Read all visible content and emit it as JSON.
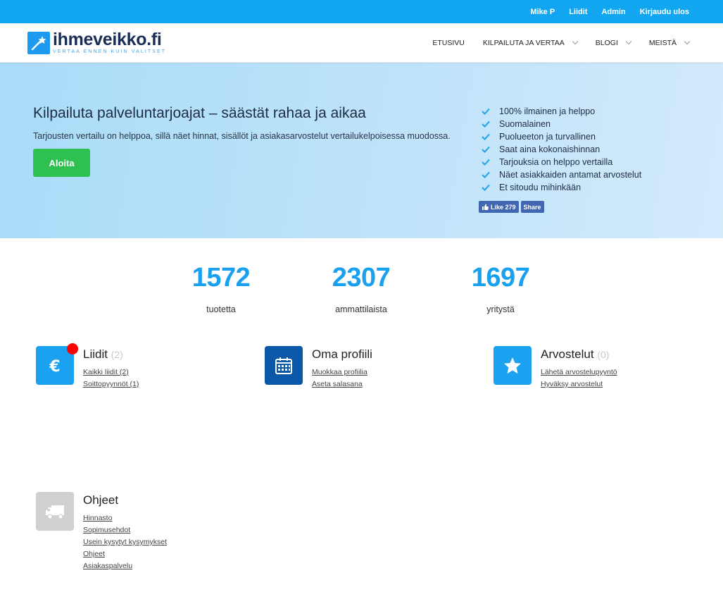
{
  "topbar": {
    "user": "Mike P",
    "leads": "Liidit",
    "admin": "Admin",
    "logout": "Kirjaudu ulos"
  },
  "header": {
    "logo_name": "ihmeveikko.fi",
    "logo_tagline": "VERTAA ENNEN KUIN VALITSET",
    "nav": [
      {
        "label": "ETUSIVU"
      },
      {
        "label": "KILPAILUTA JA VERTAA"
      },
      {
        "label": "BLOGI"
      },
      {
        "label": "MEISTÄ"
      }
    ]
  },
  "hero": {
    "title": "Kilpailuta palveluntarjoajat – säästät rahaa ja aikaa",
    "subtitle": "Tarjousten vertailu on helppoa, sillä näet hinnat, sisällöt ja asiakasarvostelut vertailukelpoisessa muodossa.",
    "cta": "Aloita",
    "benefits": [
      "100% ilmainen ja helppo",
      "Suomalainen",
      "Puolueeton ja turvallinen",
      "Saat aina kokonaishinnan",
      "Tarjouksia on helppo vertailla",
      "Näet asiakkaiden antamat arvostelut",
      "Et sitoudu mihinkään"
    ],
    "fb_like": "Like 279",
    "fb_share": "Share"
  },
  "stats": [
    {
      "value": "1572",
      "label": "tuotetta"
    },
    {
      "value": "2307",
      "label": "ammattilaista"
    },
    {
      "value": "1697",
      "label": "yritystä"
    }
  ],
  "cards": {
    "leads": {
      "title": "Liidit",
      "count": "(2)",
      "links": [
        "Kaikki liidit (2)",
        "Soittopyynnöt (1)"
      ]
    },
    "profile": {
      "title": "Oma profiili",
      "links": [
        "Muokkaa profiilia",
        "Aseta salasana"
      ]
    },
    "reviews": {
      "title": "Arvostelut",
      "count": "(0)",
      "links": [
        "Lähetä arvostelupyyntö",
        "Hyväksy arvostelut"
      ]
    },
    "help": {
      "title": "Ohjeet",
      "links": [
        "Hinnasto",
        "Sopimusehdot",
        "Usein kysytyt kysymykset",
        "Ohjeet",
        "Asiakaspalvelu"
      ]
    }
  },
  "colors": {
    "topbar": "#12a6f0",
    "accent": "#19a0ee",
    "cta": "#2fc14f",
    "profile_icon": "#0b57a8",
    "help_icon": "#d0d0d0",
    "badge": "#ff0000"
  }
}
